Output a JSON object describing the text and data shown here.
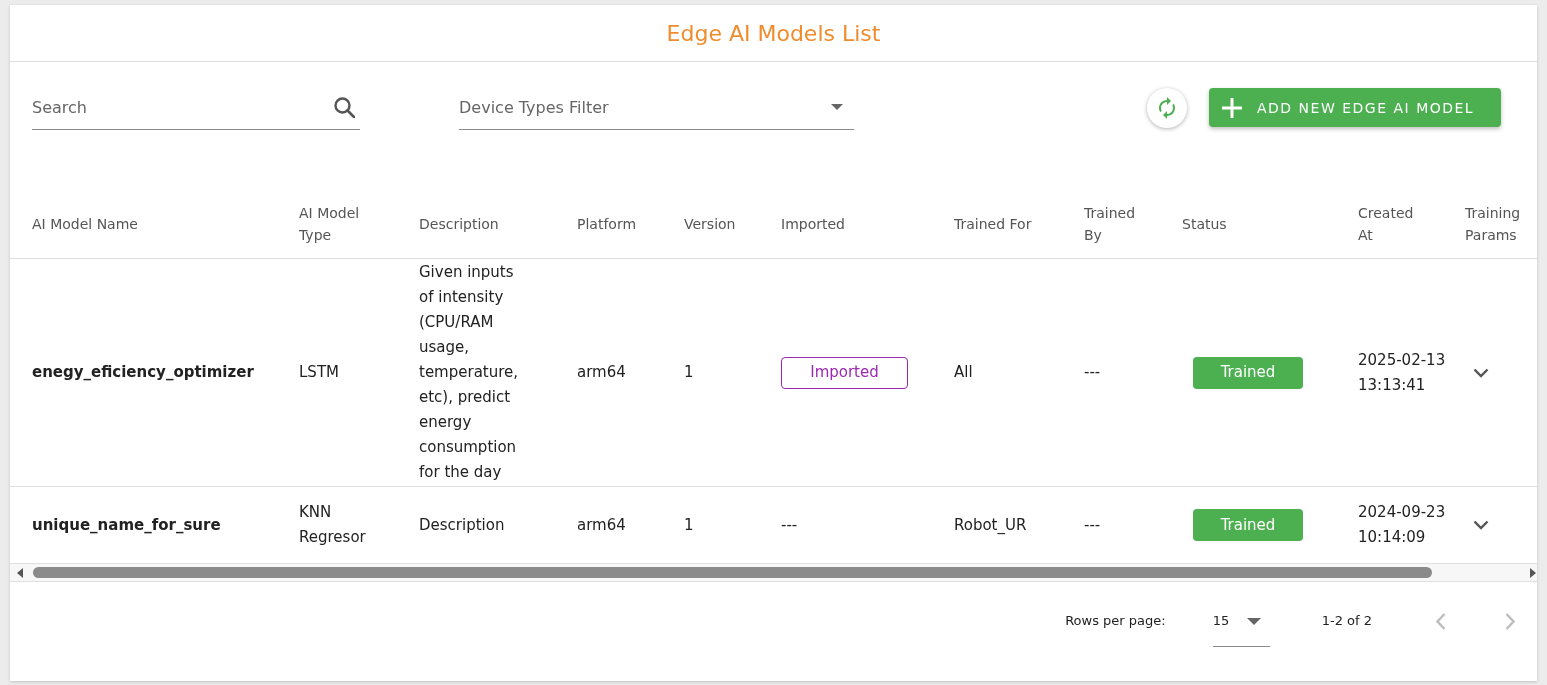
{
  "title": "Edge AI Models List",
  "toolbar": {
    "search": {
      "placeholder": "Search"
    },
    "device_types_filter": {
      "placeholder": "Device Types Filter"
    },
    "add_button": {
      "label": "ADD NEW EDGE AI MODEL"
    }
  },
  "table": {
    "columns": [
      "AI Model Name",
      "AI Model Type",
      "Description",
      "Platform",
      "Version",
      "Imported",
      "Trained For",
      "Trained By",
      "Status",
      "Created At",
      "Training Params"
    ],
    "rows": [
      {
        "name": "enegy_eficiency_optimizer",
        "model_type": "LSTM",
        "description": "Given inputs of intensity (CPU/RAM usage, temperature, etc), predict energy consumption for the day",
        "platform": "arm64",
        "version": "1",
        "imported": {
          "kind": "tag",
          "text": "Imported"
        },
        "trained_for": "All",
        "trained_by": "---",
        "status": "Trained",
        "created_at": "2025-02-13 13:13:41",
        "expanded": false
      },
      {
        "name": "unique_name_for_sure",
        "model_type": "KNN Regresor",
        "description": "Description",
        "platform": "arm64",
        "version": "1",
        "imported": {
          "kind": "text",
          "text": "---"
        },
        "trained_for": "Robot_UR",
        "trained_by": "---",
        "status": "Trained",
        "created_at": "2024-09-23 10:14:09",
        "expanded": false
      }
    ]
  },
  "pagination": {
    "rows_per_page_label": "Rows per page:",
    "rows_per_page": "15",
    "range": "1-2 of 2",
    "previous": {
      "disabled": true
    },
    "next": {
      "disabled": true
    }
  }
}
